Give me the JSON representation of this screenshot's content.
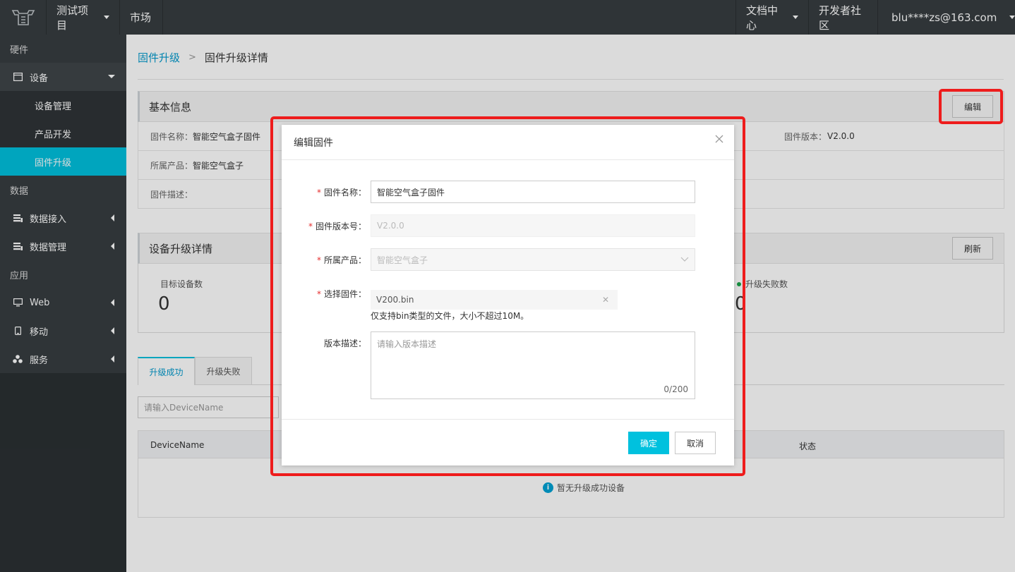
{
  "topbar": {
    "project": "测试项目",
    "market": "市场",
    "docs": "文档中心",
    "community": "开发者社区",
    "account": "blu****zs@163.com"
  },
  "sidebar": {
    "group_hardware": "硬件",
    "device": "设备",
    "device_manage": "设备管理",
    "product_dev": "产品开发",
    "firmware_upgrade": "固件升级",
    "group_data": "数据",
    "data_access": "数据接入",
    "data_manage": "数据管理",
    "group_app": "应用",
    "web": "Web",
    "mobile": "移动",
    "service": "服务"
  },
  "breadcrumb": {
    "parent": "固件升级",
    "current": "固件升级详情"
  },
  "basic_info": {
    "title": "基本信息",
    "edit_button": "编辑",
    "name_label": "固件名称：",
    "name_value": "智能空气盒子固件",
    "version_label": "固件版本：",
    "version_value": "V2.0.0",
    "product_label": "所属产品：",
    "product_value": "智能空气盒子",
    "desc_label": "固件描述："
  },
  "upgrade_detail": {
    "title": "设备升级详情",
    "refresh_button": "刷新",
    "target_label": "目标设备数",
    "target_value": "0",
    "fail_label": "升级失败数",
    "fail_value": "0"
  },
  "tabs": {
    "success": "升级成功",
    "fail": "升级失败"
  },
  "search": {
    "placeholder": "请输入DeviceName"
  },
  "table": {
    "col_device": "DeviceName",
    "col_status": "状态",
    "empty": "暂无升级成功设备"
  },
  "modal": {
    "title": "编辑固件",
    "name_label": "固件名称：",
    "name_value": "智能空气盒子固件",
    "version_label": "固件版本号：",
    "version_value": "V2.0.0",
    "product_label": "所属产品：",
    "product_value": "智能空气盒子",
    "file_label": "选择固件：",
    "file_name": "V200.bin",
    "file_hint": "仅支持bin类型的文件，大小不超过10M。",
    "desc_label": "版本描述：",
    "desc_placeholder": "请输入版本描述",
    "desc_count": "0/200",
    "ok": "确定",
    "cancel": "取消",
    "required_mark": "*"
  },
  "colors": {
    "accent": "#00c1de",
    "link": "#0099cc",
    "highlight": "#ee1c1c",
    "sidebar_bg": "#373d41"
  }
}
